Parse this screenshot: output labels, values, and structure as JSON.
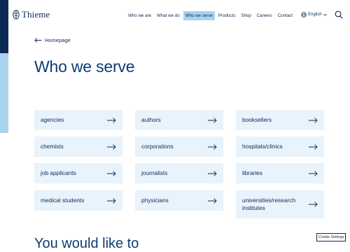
{
  "header": {
    "logo_text": "Thieme",
    "nav": [
      {
        "label": "Who we are",
        "active": false
      },
      {
        "label": "What we do",
        "active": false
      },
      {
        "label": "Who we serve",
        "active": true
      },
      {
        "label": "Products",
        "active": false
      },
      {
        "label": "Shop",
        "active": false
      },
      {
        "label": "Careers",
        "active": false
      },
      {
        "label": "Contact",
        "active": false
      }
    ],
    "language": "English"
  },
  "back_link": "Homepage",
  "page_title": "Who we serve",
  "audiences": [
    "agencies",
    "authors",
    "booksellers",
    "chemists",
    "corporations",
    "hospitals/clinics",
    "job applicants",
    "journalists",
    "libraries",
    "medical students",
    "physicians",
    "universities/research institutes"
  ],
  "next_heading": "You would like to",
  "cookie_settings": "Cookie Settings",
  "colors": {
    "brand_dark": "#0d2a57",
    "accent_light": "#a9d3ee",
    "card_bg": "#e8f3fb"
  }
}
